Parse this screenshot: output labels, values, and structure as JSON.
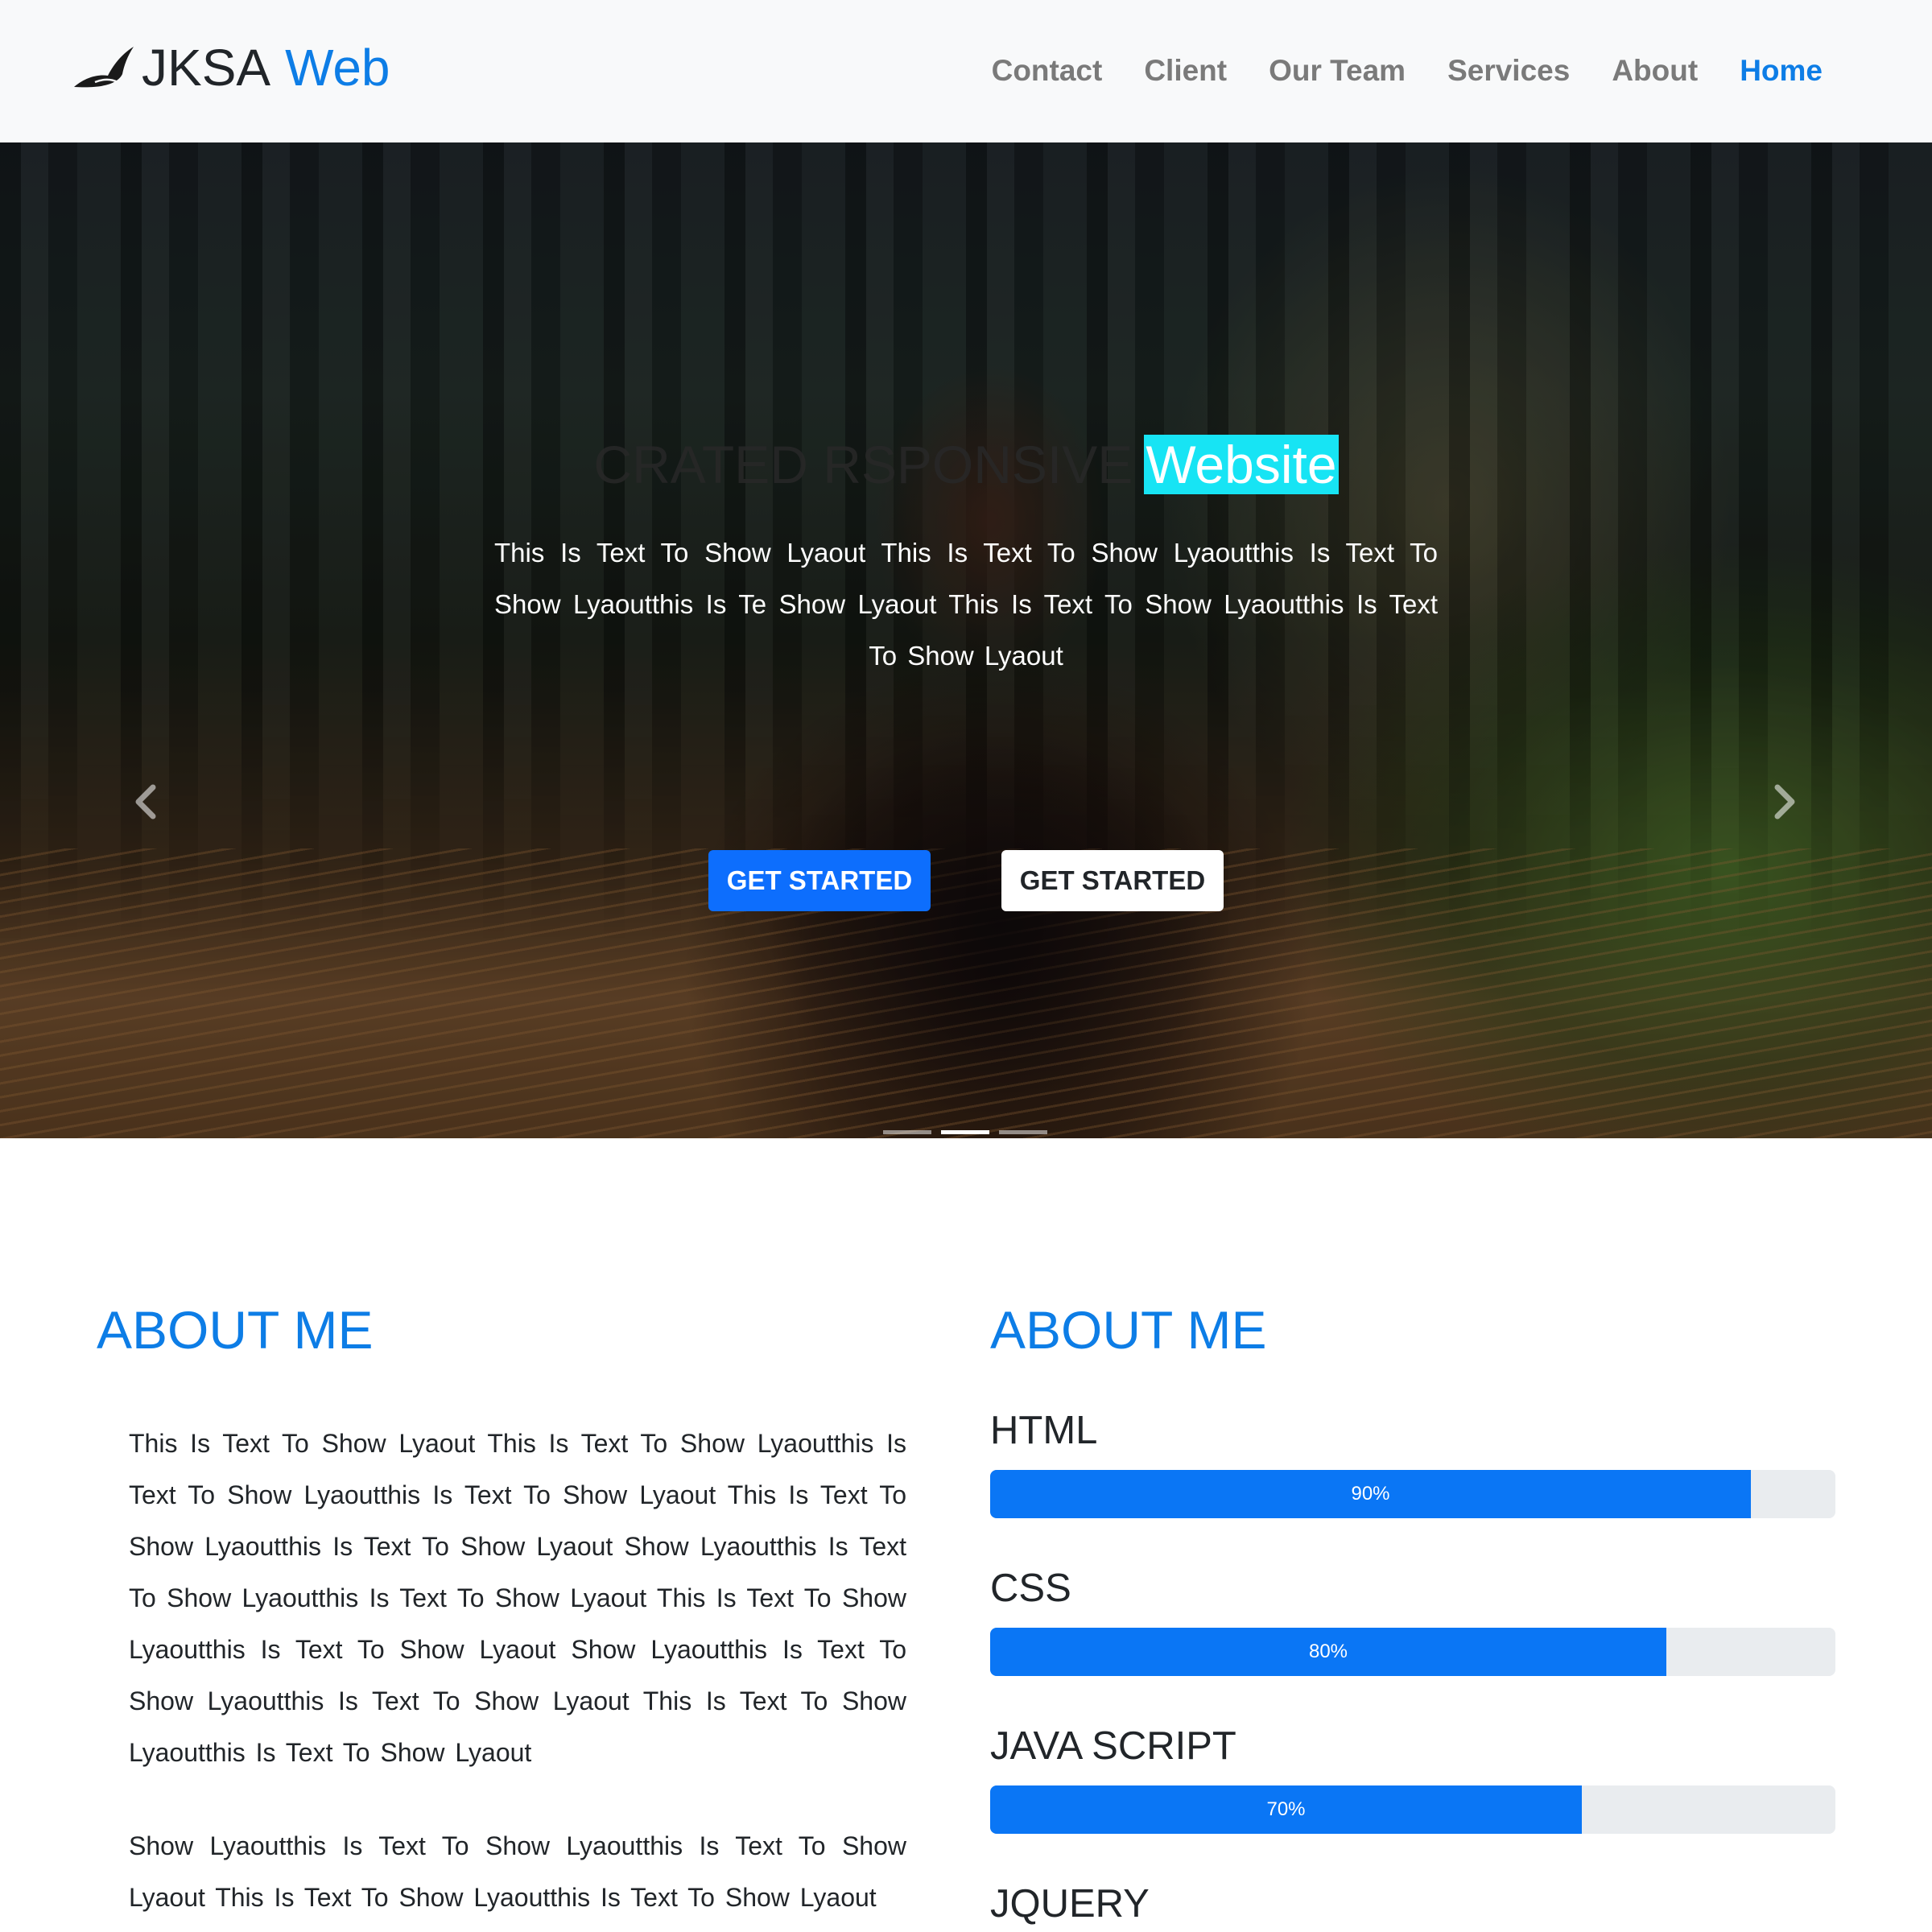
{
  "brand": {
    "name": "JKSA",
    "accent": "Web",
    "icon": "bird-icon",
    "accent_color": "#0d7de6"
  },
  "nav": {
    "items": [
      {
        "label": "Home",
        "active": true
      },
      {
        "label": "About"
      },
      {
        "label": "Services"
      },
      {
        "label": "Our Team"
      },
      {
        "label": "Client"
      },
      {
        "label": "Contact"
      }
    ]
  },
  "hero": {
    "title_dim": "CRATED RSPONSIVE",
    "title_highlight": "Website",
    "highlight_color": "#17e4f4",
    "text": "This Is Text To Show Lyaout This Is Text To Show Lyaoutthis Is Text To Show Lyaoutthis Is Te Show Lyaout This Is Text To Show Lyaoutthis Is Text To Show Lyaout",
    "buttons": [
      {
        "label": "GET STARTED",
        "style": "primary"
      },
      {
        "label": "GET STARTED",
        "style": "light"
      }
    ],
    "prev_icon": "chevron-left-icon",
    "next_icon": "chevron-right-icon",
    "slides": 3,
    "active_slide": 2
  },
  "about": {
    "left_title": "ABOUT ME",
    "paragraphs": [
      "This Is Text To Show Lyaout This Is Text To Show Lyaoutthis Is Text To Show Lyaoutthis Is Text To Show Lyaout This Is Text To Show Lyaoutthis Is Text To Show Lyaout Show Lyaoutthis Is Text To Show Lyaoutthis Is Text To Show Lyaout This Is Text To Show Lyaoutthis Is Text To Show Lyaout Show Lyaoutthis Is Text To Show Lyaoutthis Is Text To Show Lyaout This Is Text To Show Lyaoutthis Is Text To Show Lyaout",
      "Show Lyaoutthis Is Text To Show Lyaoutthis Is Text To Show Lyaout This Is Text To Show Lyaoutthis Is Text To Show Lyaout"
    ],
    "right_title": "ABOUT ME",
    "skills": [
      {
        "name": "HTML",
        "percent": 90,
        "label": "90%"
      },
      {
        "name": "CSS",
        "percent": 80,
        "label": "80%"
      },
      {
        "name": "JAVA SCRIPT",
        "percent": 70,
        "label": "70%"
      },
      {
        "name": "JQUERY"
      }
    ],
    "bar_color": "#0a76f5"
  }
}
